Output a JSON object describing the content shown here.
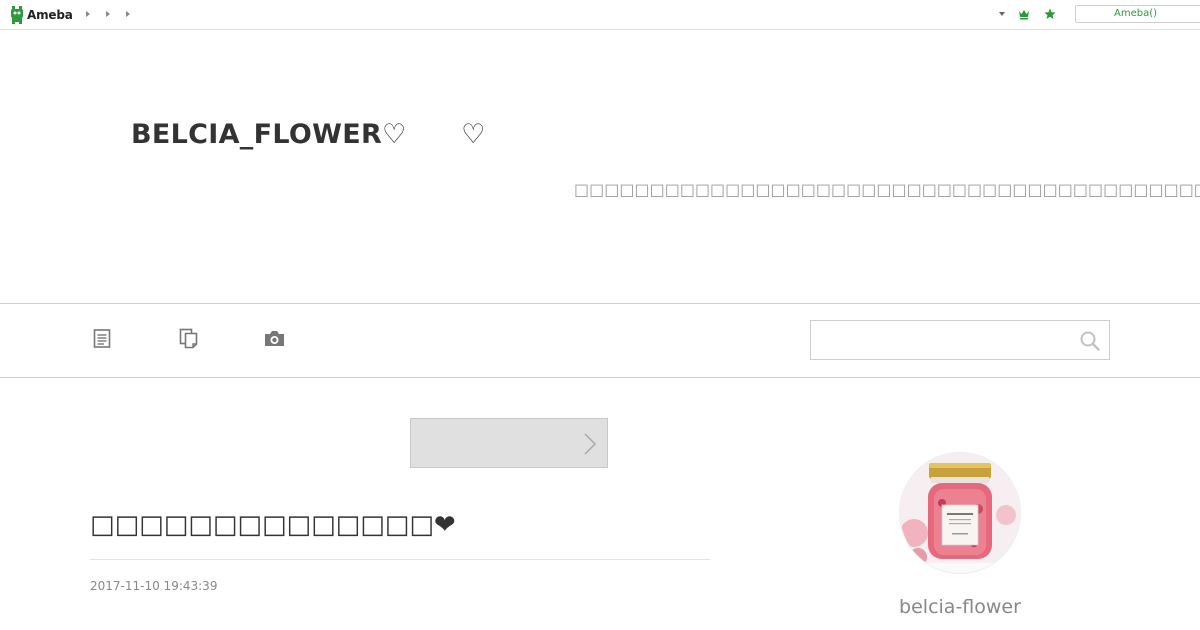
{
  "topbar": {
    "logo_text": "Ameba",
    "breadcrumbs": [
      "",
      "",
      ""
    ],
    "ameba_button_label": "Ameba()"
  },
  "header": {
    "blog_title": "BELCIA_FLOWER♡　　♡",
    "blog_description": "□□□□□□□□□□□□□□□□□□□□□□□□□□□□□□□□□□□□□□□□□□□□□□□□□□□□❤□□□□□□□□□□□□"
  },
  "nav": {
    "items": [
      {
        "icon": "entry-list-icon"
      },
      {
        "icon": "pages-icon"
      },
      {
        "icon": "camera-icon"
      }
    ],
    "search": {
      "placeholder": "",
      "value": ""
    }
  },
  "main": {
    "next_button_label": "",
    "entry_title": "□□□□□□□□□□□□□□❤",
    "entry_date": "2017-11-10 19:43:39"
  },
  "sidebar": {
    "profile_name": "belcia-flower"
  },
  "colors": {
    "ameba_green": "#2d9b3a",
    "text": "#333333",
    "muted": "#999999",
    "rule": "#cfcfcf"
  }
}
